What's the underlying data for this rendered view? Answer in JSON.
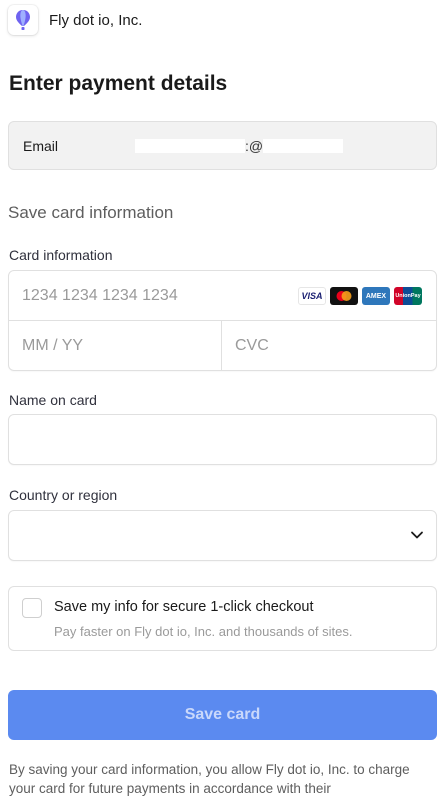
{
  "header": {
    "merchant_name": "Fly dot io, Inc.",
    "logo_icon": "balloon-icon"
  },
  "title": "Enter payment details",
  "email": {
    "label": "Email",
    "value": ":@"
  },
  "save_section_title": "Save card information",
  "card": {
    "label": "Card information",
    "number_placeholder": "1234 1234 1234 1234",
    "expiry_placeholder": "MM / YY",
    "cvc_placeholder": "CVC",
    "brands": [
      "VISA",
      "mastercard",
      "AMEX",
      "UnionPay"
    ]
  },
  "name": {
    "label": "Name on card",
    "value": ""
  },
  "country": {
    "label": "Country or region",
    "value": ""
  },
  "link": {
    "title": "Save my info for secure 1-click checkout",
    "subtitle": "Pay faster on Fly dot io, Inc. and thousands of sites."
  },
  "button": {
    "label": "Save card"
  },
  "legal": "By saving your card information, you allow Fly dot io, Inc. to charge your card for future payments in accordance with their",
  "colors": {
    "button_bg": "#5b8af0",
    "button_text": "#c9d8fb",
    "logo_blue": "#5b6cf0"
  }
}
